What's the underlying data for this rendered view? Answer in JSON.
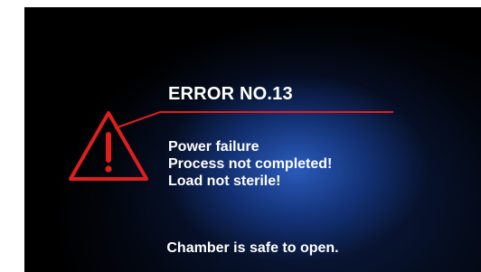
{
  "error": {
    "title": "ERROR NO.13",
    "messages": [
      "Power failure",
      "Process not completed!",
      "Load not sterile!"
    ]
  },
  "footer": {
    "text": "Chamber is safe to open."
  },
  "icons": {
    "warning": "warning-triangle-icon"
  },
  "colors": {
    "screen_background": "#000000",
    "glow": "#2c60c4",
    "accent_red": "#e01e1e",
    "text": "#ffffff"
  }
}
